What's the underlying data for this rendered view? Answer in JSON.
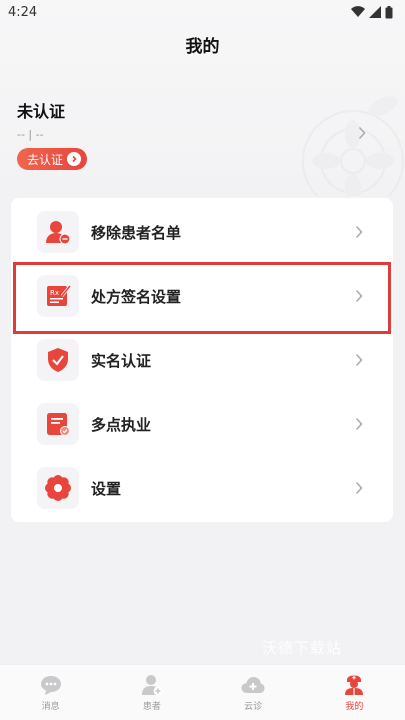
{
  "status_bar": {
    "time": "4:24"
  },
  "header": {
    "title": "我的"
  },
  "profile": {
    "name": "未认证",
    "subtitle": "-- | --",
    "verify_button": "去认证"
  },
  "menu": {
    "items": [
      {
        "label": "移除患者名单",
        "icon": "user-remove-icon"
      },
      {
        "label": "处方签名设置",
        "icon": "prescription-sign-icon"
      },
      {
        "label": "实名认证",
        "icon": "shield-check-icon"
      },
      {
        "label": "多点执业",
        "icon": "certificate-icon"
      },
      {
        "label": "设置",
        "icon": "gear-flower-icon"
      }
    ],
    "highlighted_index": 1
  },
  "watermark": "沃德下载站",
  "bottom_nav": {
    "items": [
      {
        "label": "消息",
        "icon": "chat-icon"
      },
      {
        "label": "患者",
        "icon": "patient-icon"
      },
      {
        "label": "云诊",
        "icon": "cloud-clinic-icon"
      },
      {
        "label": "我的",
        "icon": "doctor-icon"
      }
    ],
    "active_index": 3
  },
  "colors": {
    "accent": "#e8453d",
    "background": "#f2f2f4",
    "card": "#ffffff"
  }
}
